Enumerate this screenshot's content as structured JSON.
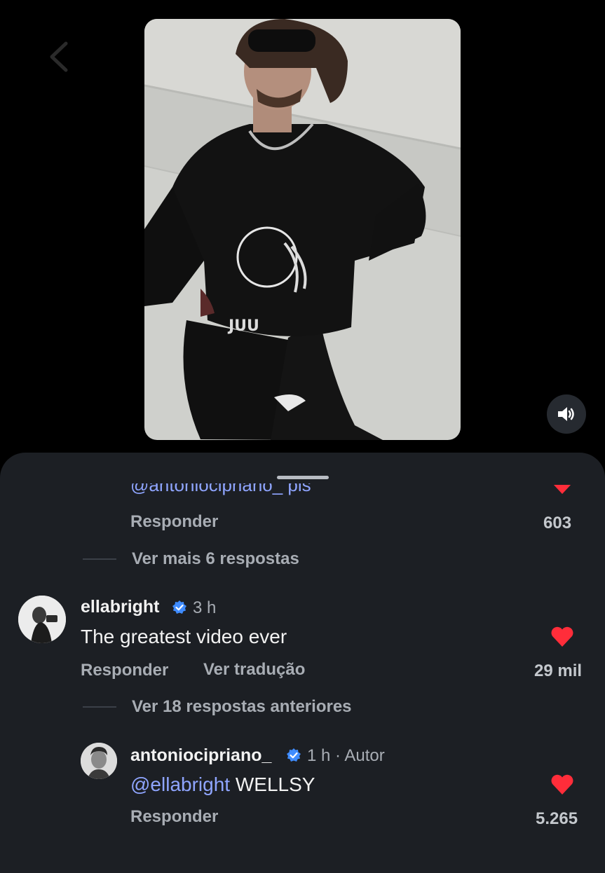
{
  "video": {
    "sound_icon": "speaker-on-icon"
  },
  "comments": {
    "top_partial": {
      "text": "@antoniocipriano_ pls",
      "reply_label": "Responder",
      "likes": "603",
      "more_replies": "Ver mais 6 respostas"
    },
    "main": {
      "username": "ellabright",
      "time": "3 h",
      "text": "The greatest video ever",
      "reply_label": "Responder",
      "translate_label": "Ver tradução",
      "likes": "29 mil",
      "previous_replies": "Ver 18 respostas anteriores"
    },
    "reply": {
      "username": "antoniocipriano_",
      "time_author": "1 h · Autor",
      "mention": "@ellabright",
      "text": " WELLSY",
      "reply_label": "Responder",
      "likes": "5.265"
    }
  },
  "colors": {
    "heart": "#ff2d3a",
    "verified": "#3f8cff",
    "mention": "#8fa5ff",
    "sheet": "#1c1f24"
  }
}
